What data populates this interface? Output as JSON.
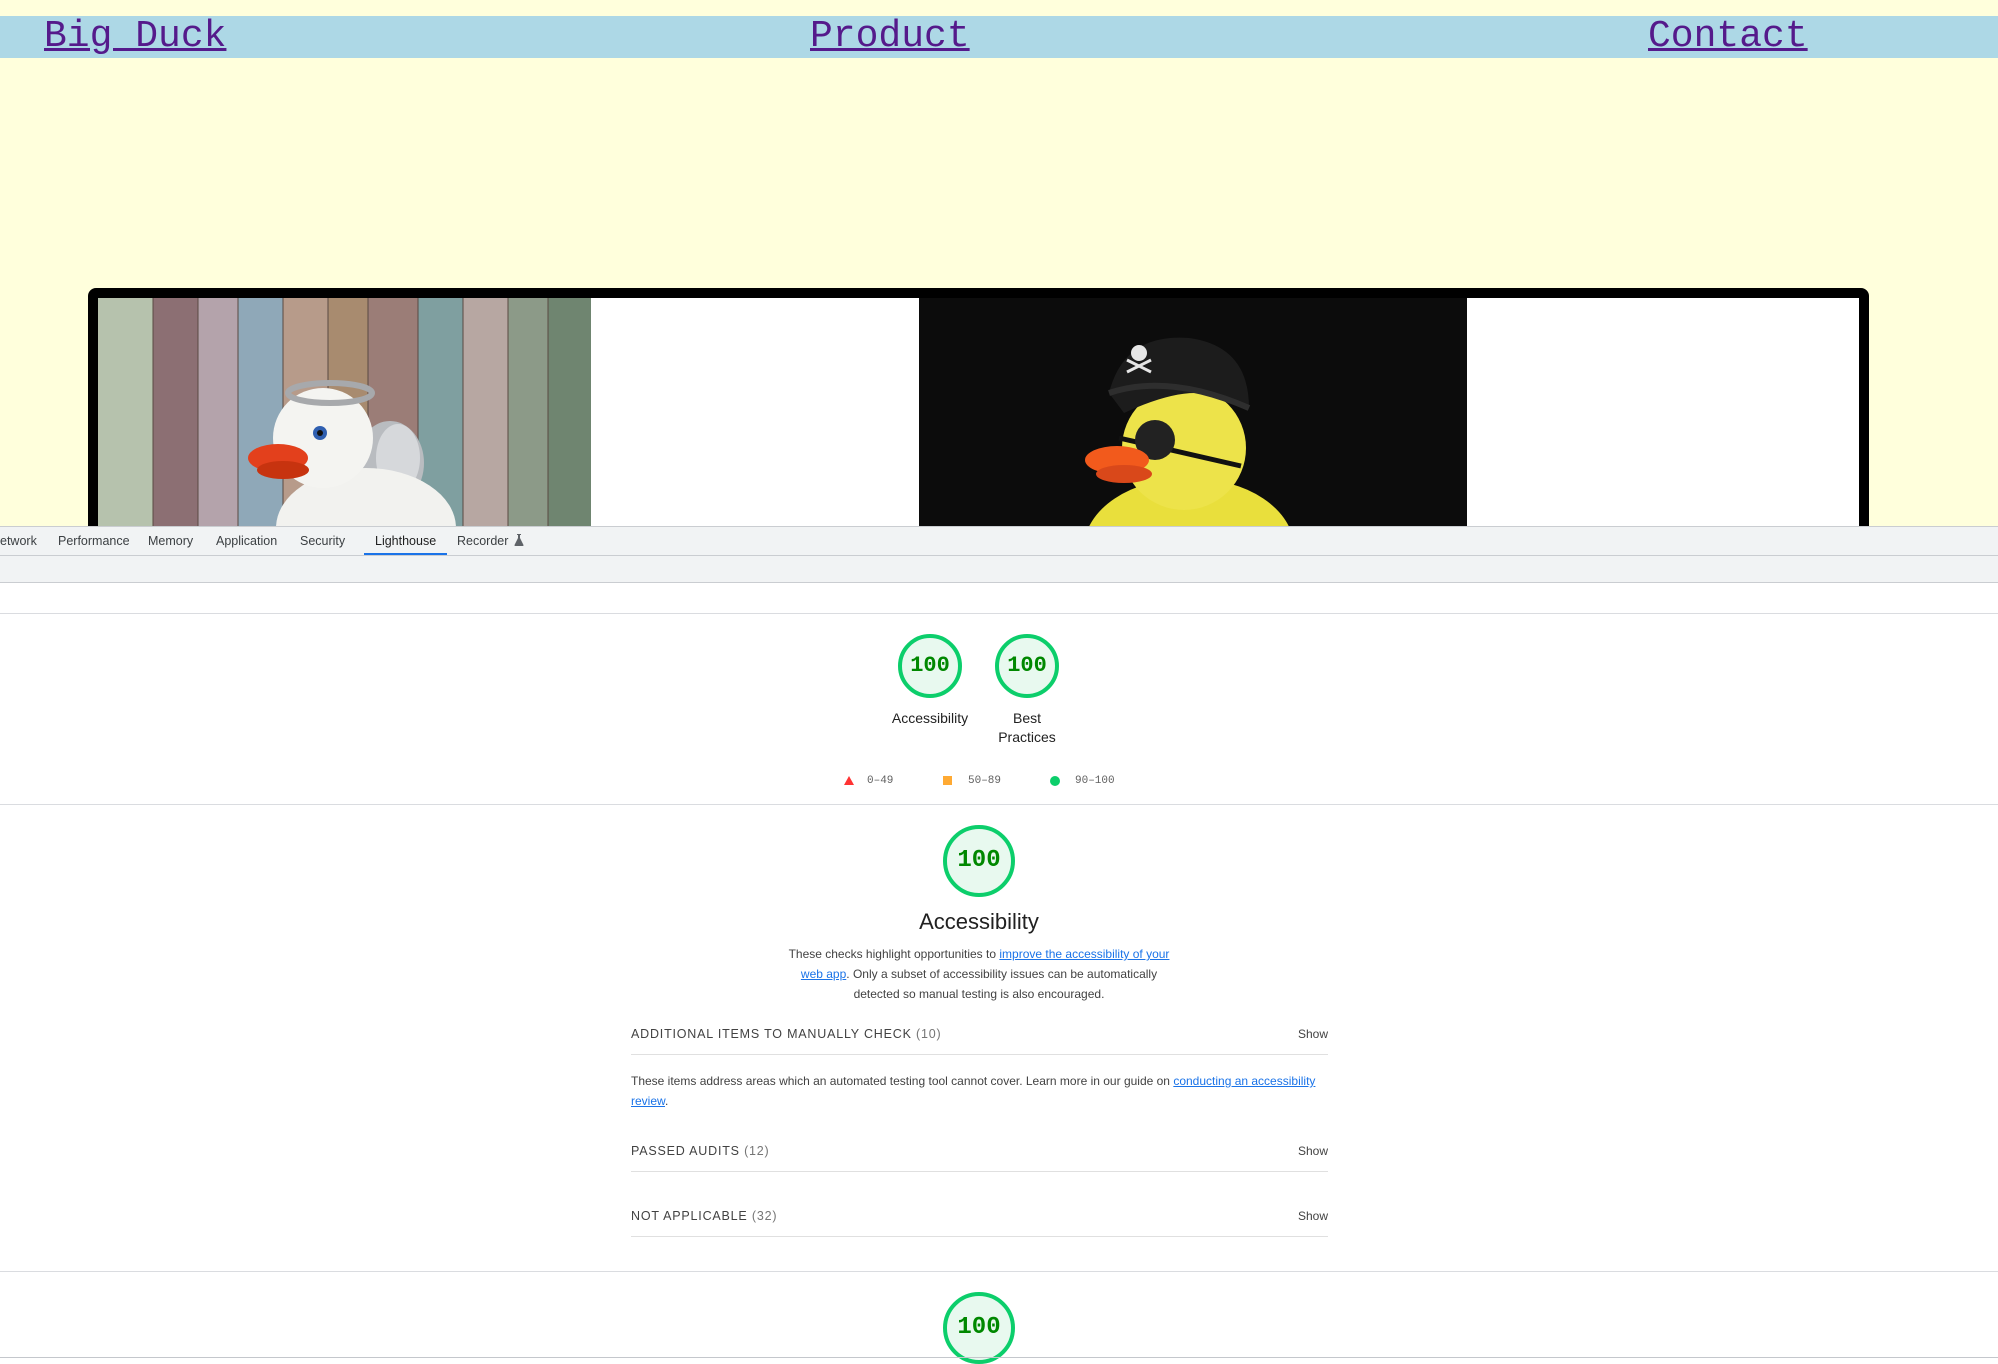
{
  "site": {
    "nav": {
      "brand": "Big Duck",
      "product": "Product",
      "contact": "Contact"
    }
  },
  "devtools": {
    "tabs": [
      {
        "label": "etwork"
      },
      {
        "label": "Performance"
      },
      {
        "label": "Memory"
      },
      {
        "label": "Application"
      },
      {
        "label": "Security"
      },
      {
        "label": "Lighthouse"
      },
      {
        "label": "Recorder"
      }
    ],
    "active_tab": "Lighthouse"
  },
  "lighthouse": {
    "summary": [
      {
        "score": "100",
        "label": "Accessibility"
      },
      {
        "score": "100",
        "label": "Best Practices"
      }
    ],
    "legend": [
      {
        "range": "0–49",
        "color": "#ff3333"
      },
      {
        "range": "50–89",
        "color": "#ffaa33"
      },
      {
        "range": "90–100",
        "color": "#0cce6b"
      }
    ],
    "accessibility": {
      "score": "100",
      "title": "Accessibility",
      "desc_pre": "These checks highlight opportunities to ",
      "desc_link": "improve the accessibility of your web app",
      "desc_post": ". Only a subset of accessibility issues can be automatically detected so manual testing is also encouraged.",
      "groups": {
        "manual": {
          "title": "ADDITIONAL ITEMS TO MANUALLY CHECK",
          "count": "(10)",
          "show": "Show"
        },
        "passed": {
          "title": "PASSED AUDITS",
          "count": "(12)",
          "show": "Show"
        },
        "not_applicable": {
          "title": "NOT APPLICABLE",
          "count": "(32)",
          "show": "Show"
        }
      },
      "manual_desc_pre": "These items address areas which an automated testing tool cannot cover. Learn more in our guide on ",
      "manual_desc_link": "conducting an accessibility review",
      "manual_desc_post": "."
    },
    "next_score": "100"
  },
  "colors": {
    "site_bg": "#ffffdc",
    "nav_bg": "#add8e6",
    "pass_green": "#0cce6b",
    "link_blue": "#1a73e8"
  }
}
